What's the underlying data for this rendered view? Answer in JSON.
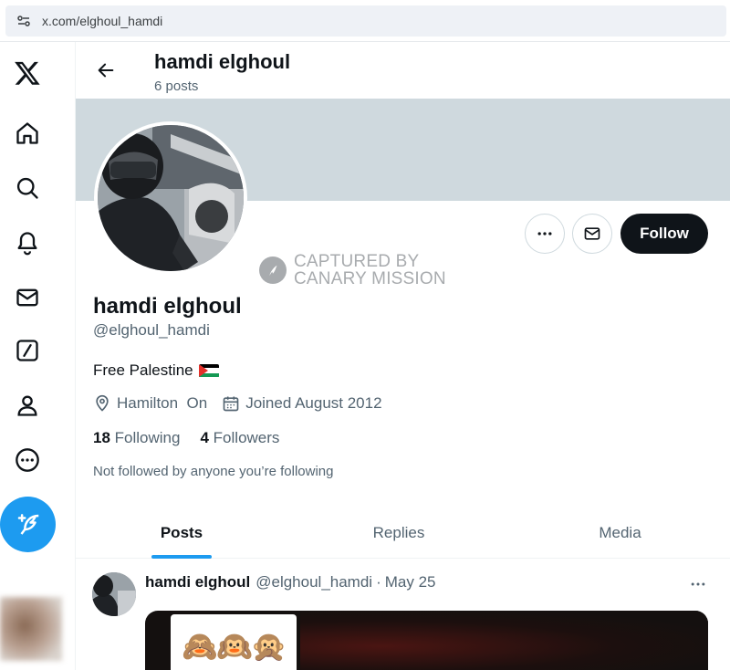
{
  "browser": {
    "url": "x.com/elghoul_hamdi"
  },
  "nav": {
    "items": [
      "x-logo",
      "home-icon",
      "search-icon",
      "notifications-icon",
      "messages-icon",
      "grok-icon",
      "profile-icon",
      "more-icon"
    ]
  },
  "header": {
    "name": "hamdi elghoul",
    "post_count": "6 posts"
  },
  "actions": {
    "more": "more-options-icon",
    "message": "mail-icon",
    "follow_label": "Follow"
  },
  "watermark": {
    "line1": "CAPTURED BY",
    "line2": "CANARY MISSION"
  },
  "profile": {
    "name": "hamdi elghoul",
    "handle": "@elghoul_hamdi",
    "bio": "Free Palestine",
    "location": "Hamilton  On",
    "joined": "Joined August 2012",
    "following_count": "18",
    "following_label": "Following",
    "followers_count": "4",
    "followers_label": "Followers",
    "not_followed_text": "Not followed by anyone you’re following"
  },
  "tabs": [
    {
      "label": "Posts",
      "active": true
    },
    {
      "label": "Replies",
      "active": false
    },
    {
      "label": "Media",
      "active": false
    }
  ],
  "post": {
    "name": "hamdi elghoul",
    "handle": "@elghoul_hamdi",
    "separator": "·",
    "date": "May 25",
    "media_emoji": "🙈🙉🙊"
  },
  "colors": {
    "accent": "#1d9bf0",
    "banner": "#cfd9de",
    "text": "#0f1419",
    "muted": "#536471"
  }
}
